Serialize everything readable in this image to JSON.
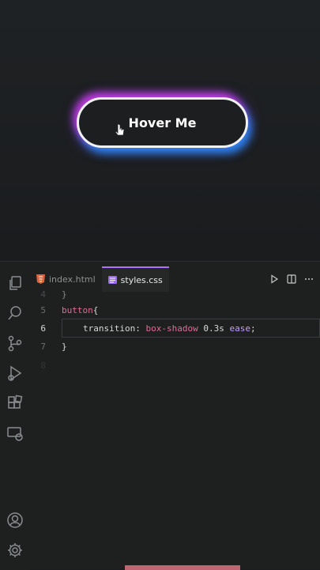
{
  "preview": {
    "button_label": "Hover Me",
    "glow_colors": {
      "top": "#c83ce6",
      "bottom": "#288cff"
    }
  },
  "editor": {
    "tabs": [
      {
        "label": "index.html",
        "icon": "html-file-icon",
        "active": false
      },
      {
        "label": "styles.css",
        "icon": "css-file-icon",
        "active": true
      }
    ],
    "actions": [
      "run-icon",
      "split-editor-icon",
      "more-icon"
    ],
    "activity_icons": [
      "explorer-icon",
      "search-icon",
      "source-control-icon",
      "run-debug-icon",
      "extensions-icon",
      "remote-explorer-icon",
      "account-icon",
      "settings-gear-icon"
    ],
    "lines": [
      {
        "no": "4",
        "text": "}"
      },
      {
        "no": "5",
        "selector": "button",
        "brace": "{"
      },
      {
        "no": "6",
        "prop": "transition",
        "colon": ":",
        "value": "box-shadow",
        "num": "0.3s",
        "ease": "ease",
        "semi": ";"
      },
      {
        "no": "7",
        "text": "}"
      },
      {
        "no": "8",
        "text": ""
      }
    ],
    "accent_color": "#b070ff"
  }
}
